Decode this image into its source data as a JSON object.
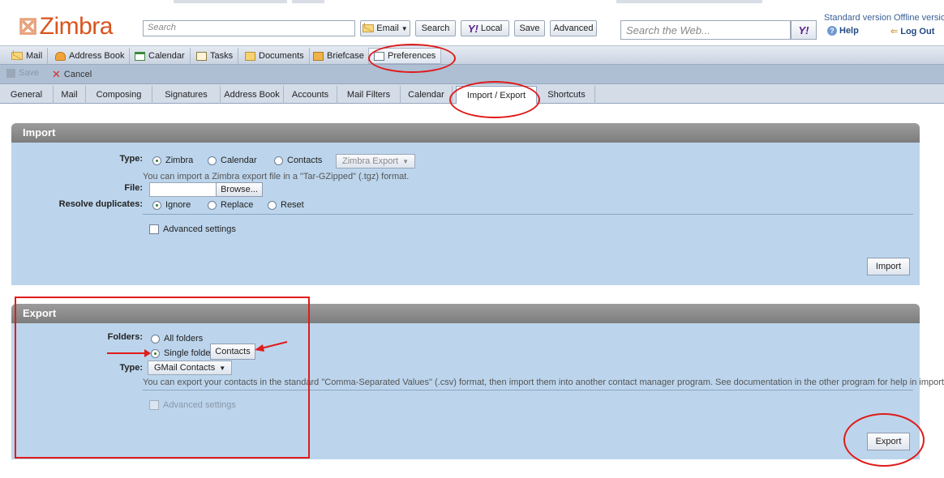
{
  "header": {
    "logo_text": "Zimbra",
    "search_placeholder": "Search",
    "search_type": "Email",
    "search_button": "Search",
    "local_button": "Local",
    "save_button": "Save",
    "advanced_button": "Advanced",
    "web_search_placeholder": "Search the Web...",
    "standard_version": "Standard version",
    "offline_version": "Offline version",
    "help": "Help",
    "logout": "Log Out"
  },
  "app_tabs": [
    {
      "label": "Mail"
    },
    {
      "label": "Address Book"
    },
    {
      "label": "Calendar"
    },
    {
      "label": "Tasks"
    },
    {
      "label": "Documents"
    },
    {
      "label": "Briefcase"
    },
    {
      "label": "Preferences"
    }
  ],
  "actions": {
    "save": "Save",
    "cancel": "Cancel"
  },
  "pref_tabs": [
    {
      "label": "General"
    },
    {
      "label": "Mail"
    },
    {
      "label": "Composing"
    },
    {
      "label": "Signatures"
    },
    {
      "label": "Address Book"
    },
    {
      "label": "Accounts"
    },
    {
      "label": "Mail Filters"
    },
    {
      "label": "Calendar"
    },
    {
      "label": "Import / Export"
    },
    {
      "label": "Shortcuts"
    }
  ],
  "import": {
    "title": "Import",
    "type_label": "Type:",
    "type_options": [
      "Zimbra",
      "Calendar",
      "Contacts"
    ],
    "type_selected": "Zimbra",
    "format_dropdown": "Zimbra Export",
    "hint": "You can import a Zimbra export file in a \"Tar-GZipped\" (.tgz) format.",
    "file_label": "File:",
    "browse_button": "Browse...",
    "resolve_label": "Resolve duplicates:",
    "resolve_options": [
      "Ignore",
      "Replace",
      "Reset"
    ],
    "resolve_selected": "Ignore",
    "advanced_settings": "Advanced settings",
    "import_button": "Import"
  },
  "export": {
    "title": "Export",
    "folders_label": "Folders:",
    "all_folders": "All folders",
    "single_folder": "Single folder",
    "folder_button": "Contacts",
    "type_label": "Type:",
    "type_dropdown": "GMail Contacts",
    "hint": "You can export your contacts in the standard \"Comma-Separated Values\" (.csv) format, then import them into another contact manager program. See documentation in the other program for help in importing.",
    "advanced_settings": "Advanced settings",
    "export_button": "Export"
  },
  "colors": {
    "accent_red": "#e01b1b",
    "panel_bg": "#bcd5ec",
    "logo": "#d9541e"
  }
}
